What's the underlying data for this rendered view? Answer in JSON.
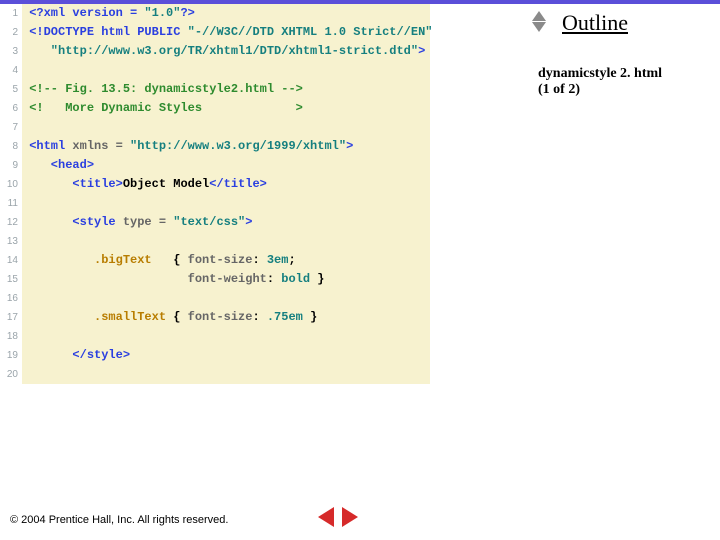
{
  "sidebar": {
    "outline_label": "Outline",
    "filename_line1": "dynamicstyle 2. html",
    "filename_line2": "(1 of 2)"
  },
  "footer": {
    "copyright": "© 2004 Prentice Hall, Inc.  All rights reserved."
  },
  "code": {
    "lines": [
      {
        "n": "1",
        "tokens": [
          {
            "cls": "c-tag",
            "pad": 0,
            "t": "<?xml version = "
          },
          {
            "cls": "c-str",
            "pad": 0,
            "t": "\"1.0\""
          },
          {
            "cls": "c-tag",
            "pad": 0,
            "t": "?>"
          }
        ]
      },
      {
        "n": "2",
        "tokens": [
          {
            "cls": "c-tag",
            "pad": 0,
            "t": "<!DOCTYPE html PUBLIC "
          },
          {
            "cls": "c-str",
            "pad": 0,
            "t": "\"-//W3C//DTD XHTML 1.0 Strict//EN\""
          }
        ]
      },
      {
        "n": "3",
        "tokens": [
          {
            "cls": "c-str",
            "pad": 3,
            "t": "\"http://www.w3.org/TR/xhtml1/DTD/xhtml1-strict.dtd\""
          },
          {
            "cls": "c-tag",
            "pad": 0,
            "t": ">"
          }
        ]
      },
      {
        "n": "4",
        "tokens": []
      },
      {
        "n": "5",
        "tokens": [
          {
            "cls": "c-comment",
            "pad": 0,
            "t": "<!-- Fig. 13.5: dynamicstyle2.html -->"
          }
        ]
      },
      {
        "n": "6",
        "tokens": [
          {
            "cls": "c-comment",
            "pad": 0,
            "t": "<!   More Dynamic Styles             >"
          }
        ]
      },
      {
        "n": "7",
        "tokens": []
      },
      {
        "n": "8",
        "tokens": [
          {
            "cls": "c-tag",
            "pad": 0,
            "t": "<html "
          },
          {
            "cls": "c-attr",
            "pad": 0,
            "t": "xmlns = "
          },
          {
            "cls": "c-str",
            "pad": 0,
            "t": "\"http://www.w3.org/1999/xhtml\""
          },
          {
            "cls": "c-tag",
            "pad": 0,
            "t": ">"
          }
        ]
      },
      {
        "n": "9",
        "tokens": [
          {
            "cls": "c-tag",
            "pad": 3,
            "t": "<head>"
          }
        ]
      },
      {
        "n": "10",
        "tokens": [
          {
            "cls": "c-tag",
            "pad": 6,
            "t": "<title>"
          },
          {
            "cls": "c-plain",
            "pad": 0,
            "t": "Object Model"
          },
          {
            "cls": "c-tag",
            "pad": 0,
            "t": "</title>"
          }
        ]
      },
      {
        "n": "11",
        "tokens": []
      },
      {
        "n": "12",
        "tokens": [
          {
            "cls": "c-tag",
            "pad": 6,
            "t": "<style "
          },
          {
            "cls": "c-attr",
            "pad": 0,
            "t": "type = "
          },
          {
            "cls": "c-str",
            "pad": 0,
            "t": "\"text/css\""
          },
          {
            "cls": "c-tag",
            "pad": 0,
            "t": ">"
          }
        ]
      },
      {
        "n": "13",
        "tokens": []
      },
      {
        "n": "14",
        "tokens": [
          {
            "cls": "c-sel",
            "pad": 9,
            "t": ".bigText   "
          },
          {
            "cls": "c-plain",
            "pad": 0,
            "t": "{ "
          },
          {
            "cls": "c-attr",
            "pad": 0,
            "t": "font-size"
          },
          {
            "cls": "c-plain",
            "pad": 0,
            "t": ": "
          },
          {
            "cls": "c-str",
            "pad": 0,
            "t": "3em"
          },
          {
            "cls": "c-plain",
            "pad": 0,
            "t": ";"
          }
        ]
      },
      {
        "n": "15",
        "tokens": [
          {
            "cls": "c-attr",
            "pad": 22,
            "t": "font-weight"
          },
          {
            "cls": "c-plain",
            "pad": 0,
            "t": ": "
          },
          {
            "cls": "c-str",
            "pad": 0,
            "t": "bold"
          },
          {
            "cls": "c-plain",
            "pad": 0,
            "t": " }"
          }
        ]
      },
      {
        "n": "16",
        "tokens": []
      },
      {
        "n": "17",
        "tokens": [
          {
            "cls": "c-sel",
            "pad": 9,
            "t": ".smallText "
          },
          {
            "cls": "c-plain",
            "pad": 0,
            "t": "{ "
          },
          {
            "cls": "c-attr",
            "pad": 0,
            "t": "font-size"
          },
          {
            "cls": "c-plain",
            "pad": 0,
            "t": ": "
          },
          {
            "cls": "c-str",
            "pad": 0,
            "t": ".75em"
          },
          {
            "cls": "c-plain",
            "pad": 0,
            "t": " }"
          }
        ]
      },
      {
        "n": "18",
        "tokens": []
      },
      {
        "n": "19",
        "tokens": [
          {
            "cls": "c-tag",
            "pad": 6,
            "t": "</style>"
          }
        ]
      },
      {
        "n": "20",
        "tokens": []
      }
    ]
  }
}
